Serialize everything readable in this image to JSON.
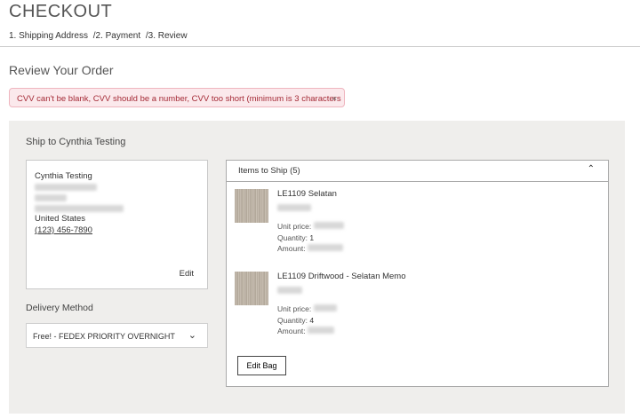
{
  "page": {
    "title": "CHECKOUT"
  },
  "steps": [
    "1. Shipping Address",
    "/2. Payment",
    "/3. Review"
  ],
  "review": {
    "title": "Review Your Order"
  },
  "alert": {
    "message": "CVV can't be blank, CVV should be a number, CVV too short (minimum is 3 characters",
    "close": "×"
  },
  "shipping": {
    "title": "Ship to Cynthia Testing",
    "name": "Cynthia Testing",
    "country": "United States",
    "phone": "(123) 456-7890",
    "edit_label": "Edit"
  },
  "delivery": {
    "title": "Delivery Method",
    "selected": "Free! - FEDEX PRIORITY OVERNIGHT",
    "chevron": "⌄"
  },
  "items": {
    "header": "Items to Ship (5)",
    "chevron": "⌃",
    "list": [
      {
        "name": "LE1109 Selatan",
        "unit_price_label": "Unit price:",
        "quantity_label": "Quantity:",
        "quantity": "1",
        "amount_label": "Amount:"
      },
      {
        "name": "LE1109 Driftwood - Selatan Memo",
        "unit_price_label": "Unit price:",
        "quantity_label": "Quantity:",
        "quantity": "4",
        "amount_label": "Amount:"
      }
    ],
    "edit_bag_label": "Edit Bag"
  }
}
